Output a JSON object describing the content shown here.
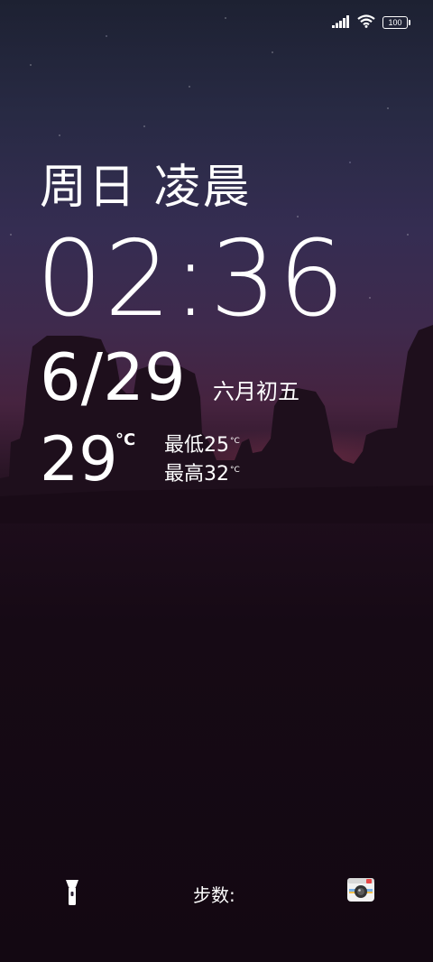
{
  "status_bar": {
    "battery_level": "100",
    "icons": [
      "signal-icon",
      "wifi-icon",
      "battery-icon"
    ]
  },
  "lock_screen": {
    "day_label": "周日 凌晨",
    "time": "02:36",
    "date": "6/29",
    "lunar_date": "六月初五",
    "weather": {
      "temperature": "29",
      "temperature_unit": "°C",
      "low_label": "最低",
      "low_value": "25",
      "high_label": "最高",
      "high_value": "32",
      "range_unit": "°C"
    }
  },
  "bottom_bar": {
    "steps_label": "步数:",
    "left_icon": "flashlight-icon",
    "right_icon": "camera-icon"
  },
  "colors": {
    "text": "#ffffff",
    "camera_red": "#e84545",
    "background_dark": "#130812"
  }
}
